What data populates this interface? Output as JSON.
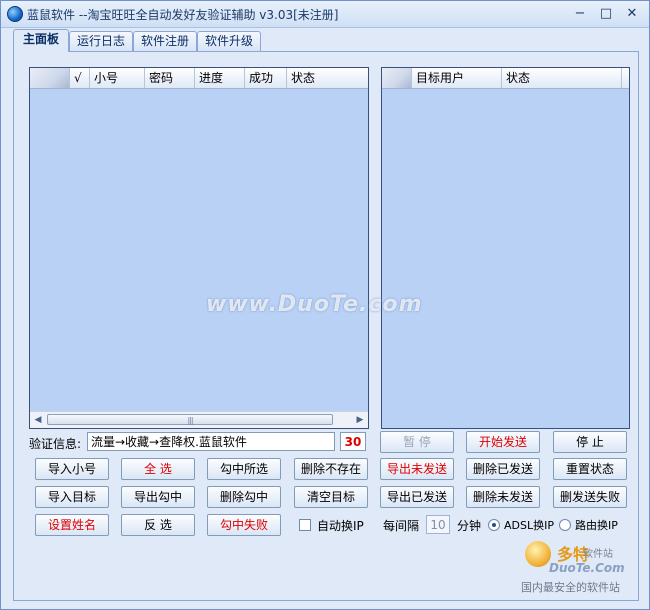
{
  "window": {
    "title": "蓝鼠软件 --淘宝旺旺全自动发好友验证辅助  v3.03[未注册]",
    "minimize": "−",
    "maximize": "□",
    "close": "✕"
  },
  "tabs": [
    "主面板",
    "运行日志",
    "软件注册",
    "软件升级"
  ],
  "left_table": {
    "columns": [
      "",
      "√",
      "小号",
      "密码",
      "进度",
      "成功",
      "状态"
    ],
    "rows": []
  },
  "right_table": {
    "columns": [
      "",
      "目标用户",
      "状态"
    ],
    "rows": []
  },
  "info": {
    "label": "验证信息:",
    "value": "流量→收藏→查降权.蓝鼠软件",
    "count": "30"
  },
  "buttons": {
    "pause": "暂 停",
    "start_send": "开始发送",
    "stop": "停 止",
    "import_accounts": "导入小号",
    "select_all": "全 选",
    "check_selected": "勾中所选",
    "delete_not_exist": "删除不存在",
    "export_unsent": "导出未发送",
    "delete_sent": "删除已发送",
    "reset_status": "重置状态",
    "import_targets": "导入目标",
    "export_checked": "导出勾中",
    "delete_checked": "删除勾中",
    "clear_targets": "清空目标",
    "export_sent": "导出已发送",
    "delete_unsent": "删除未发送",
    "delete_send_failed": "删发送失败",
    "set_name": "设置姓名",
    "invert_select": "反 选",
    "check_failed": "勾中失败"
  },
  "options": {
    "auto_ip_label": "自动换IP",
    "interval_label": "每间隔",
    "interval_value": "10",
    "minute_label": "分钟",
    "adsl_label": "ADSL换IP",
    "router_label": "路由换IP"
  },
  "watermark": "www.DuoTe.com",
  "corner_logo": {
    "main": "多特",
    "sub": "软件站",
    "site": "DuoTe.Com",
    "slogan": "国内最安全的软件站"
  }
}
